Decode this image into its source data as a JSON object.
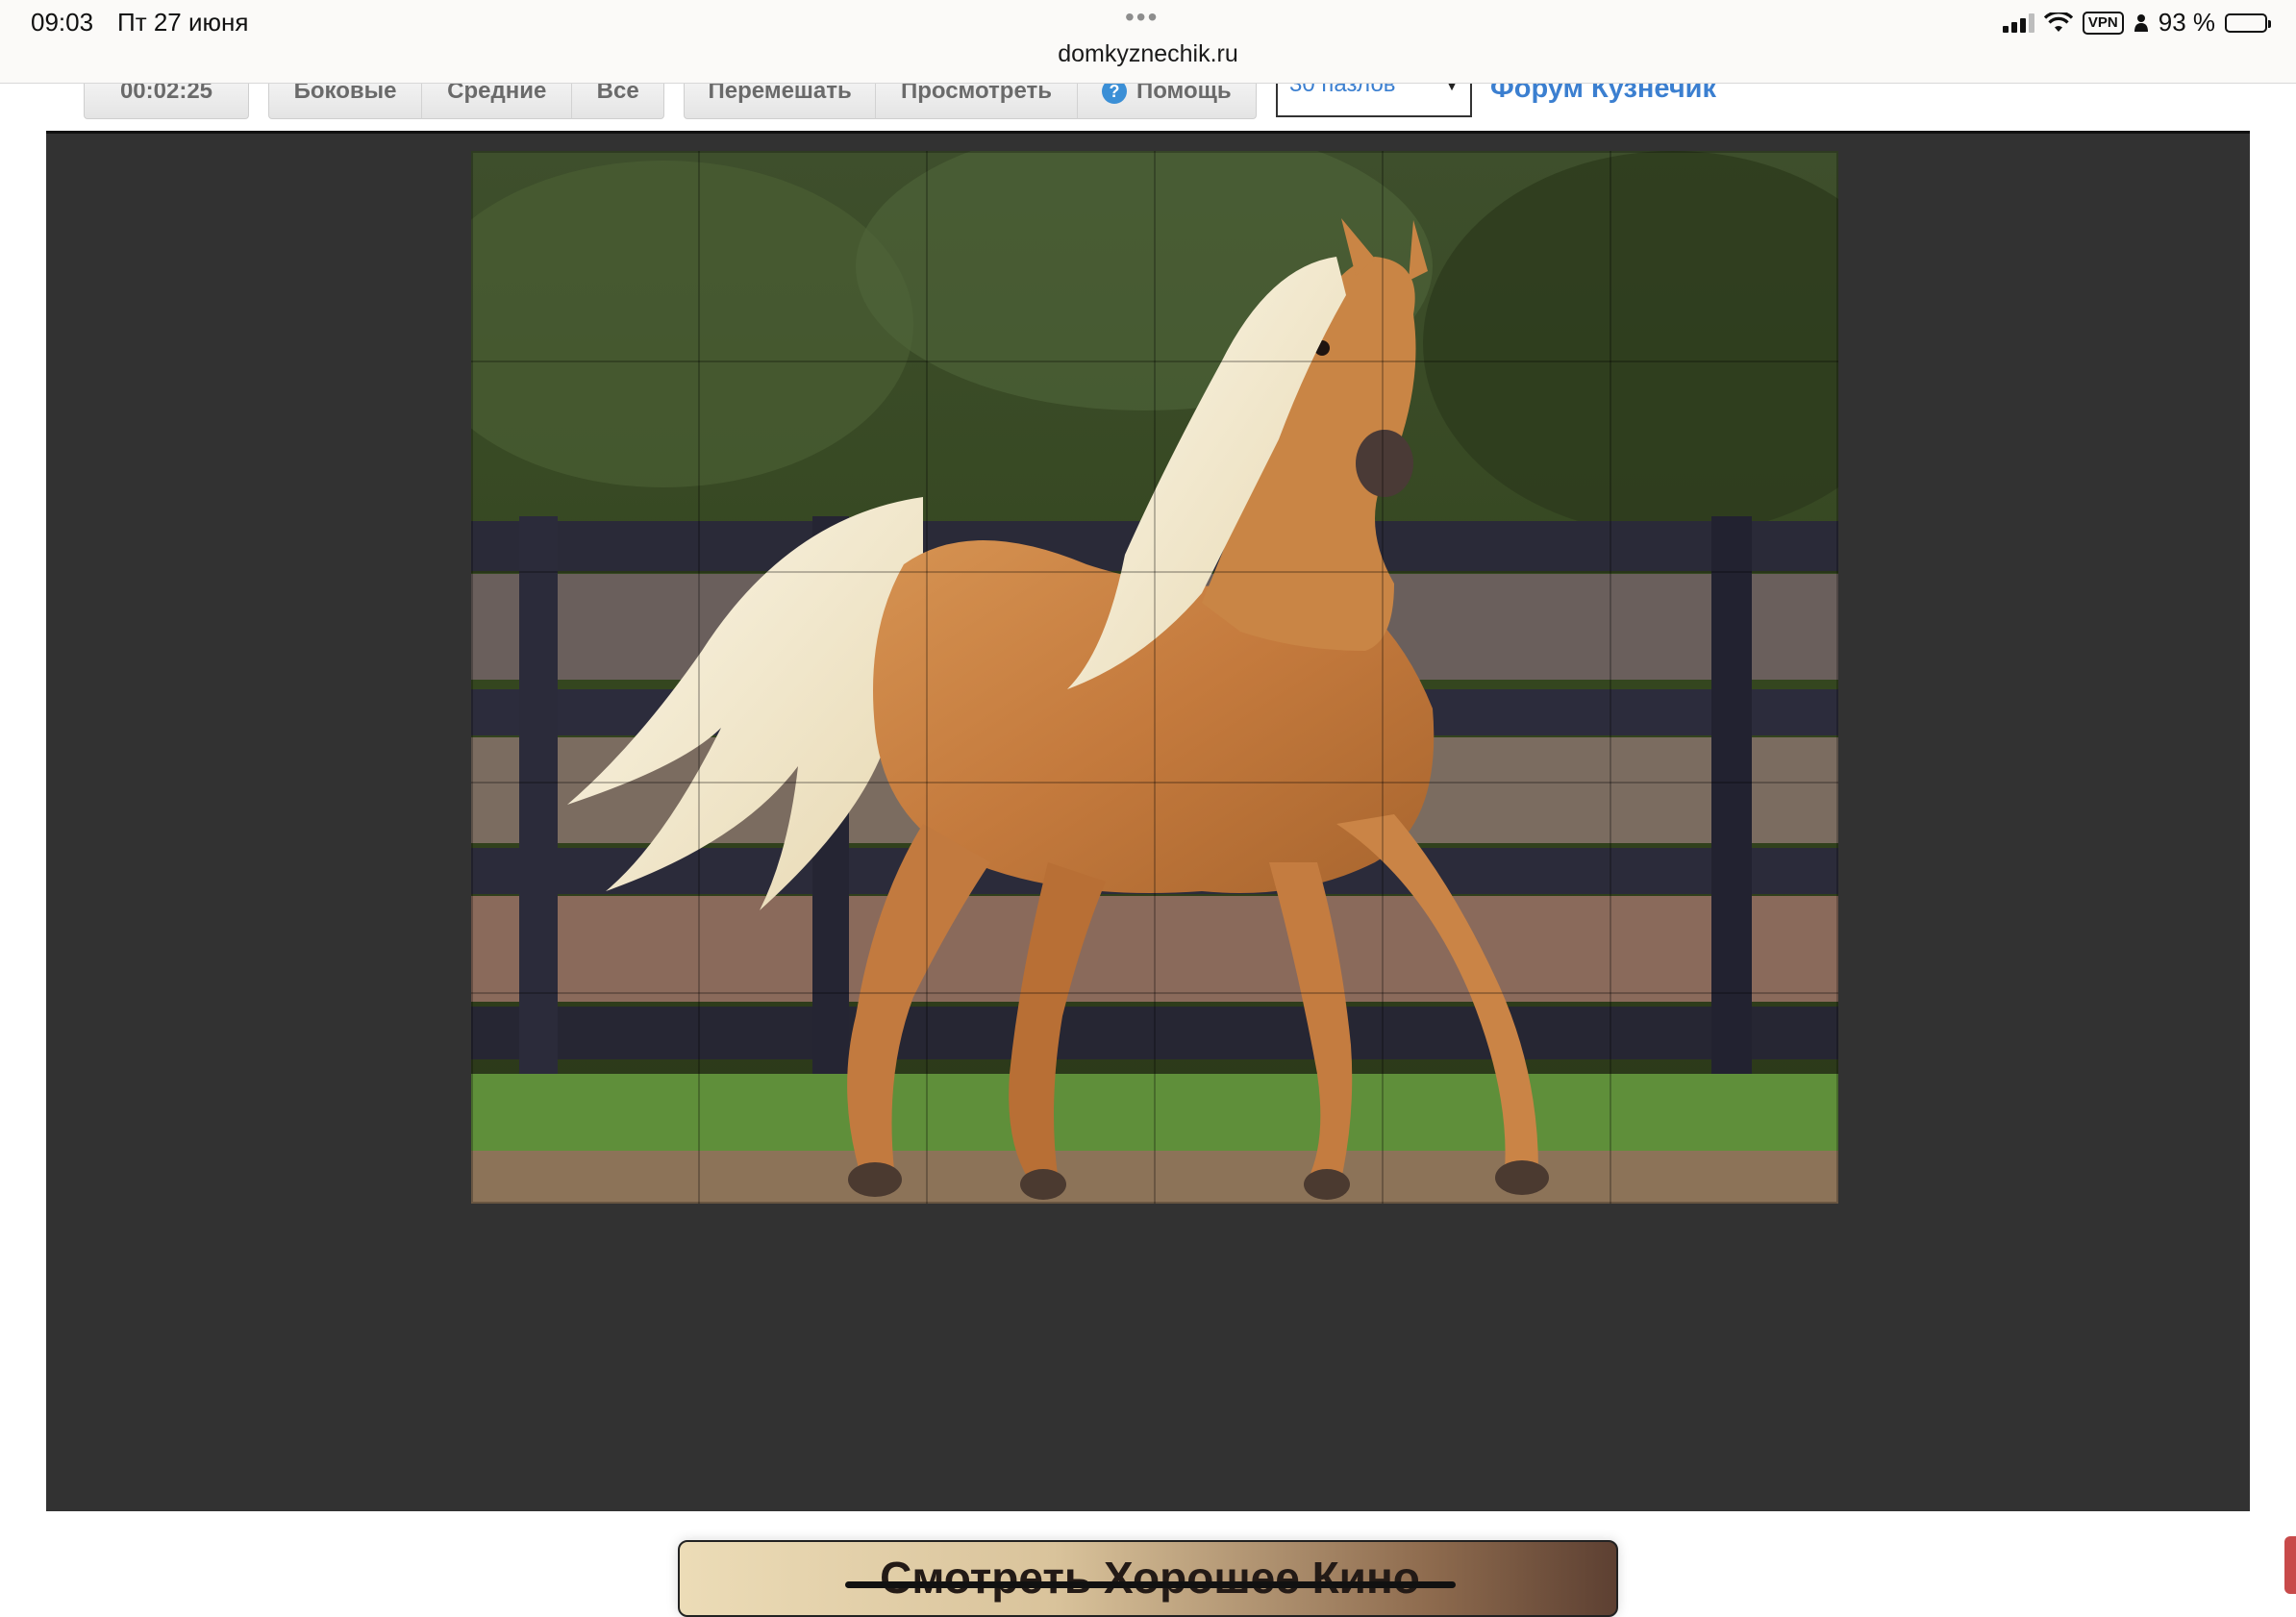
{
  "status_bar": {
    "time": "09:03",
    "date": "Пт 27 июня",
    "dots": "•••",
    "url": "domkyznechik.ru",
    "vpn": "VPN",
    "battery": "93 %",
    "battery_level": 0.93
  },
  "toolbar": {
    "timer": "00:02:25",
    "edges_label": "Боковые",
    "middle_label": "Средние",
    "all_label": "Все",
    "shuffle_label": "Перемешать",
    "preview_label": "Просмотреть",
    "help_label": "Помощь",
    "help_icon": "?",
    "pieces_select": "30 пазлов",
    "select_arrow": "▼",
    "forum_link": "Форум Кузнечик"
  },
  "puzzle": {
    "image": "palomino-horse-running",
    "columns": 6,
    "rows": 5
  },
  "ad": {
    "text": "Смотреть Хорошее Кино"
  },
  "colors": {
    "board_bg": "#323232",
    "link": "#3b7fd0",
    "button_text": "#6a6a6a"
  }
}
